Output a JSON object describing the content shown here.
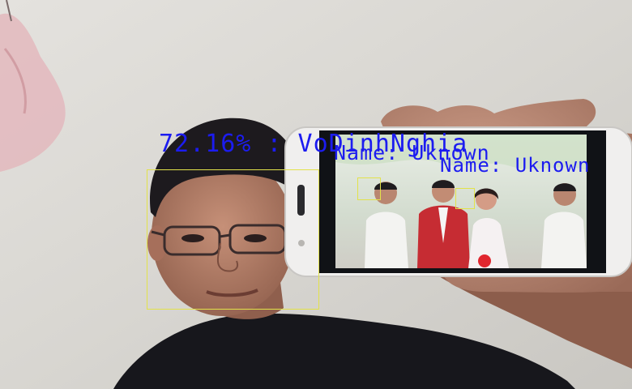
{
  "colors": {
    "wall": "#dcdad6",
    "label_text": "#1c1cf0",
    "box_stroke": "#e2e24a",
    "shirt": "#17171c",
    "skin": "#b0806c",
    "hair": "#1d1a1e",
    "phone_body": "#f0efee",
    "phone_screen": "#101216",
    "photo_bg": "#dde6da",
    "groom_suit": "#c62c33",
    "bride_dress": "#f5f1f2"
  },
  "detections": [
    {
      "label": "72.16% : VoDinhNghia"
    },
    {
      "label": "Name: Uknown"
    },
    {
      "label": "Name: Uknown"
    }
  ]
}
